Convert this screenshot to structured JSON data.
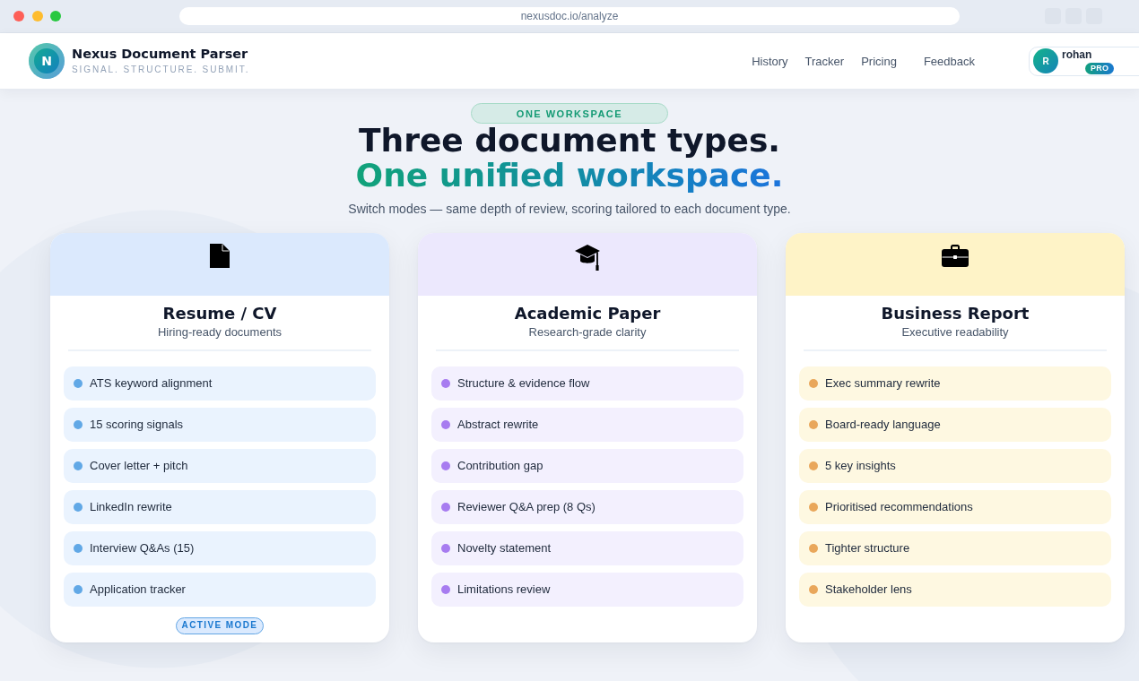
{
  "browser": {
    "url": "nexusdoc.io/analyze"
  },
  "header": {
    "logo_letter": "N",
    "title": "Nexus Document Parser",
    "tagline": "SIGNAL. STRUCTURE. SUBMIT.",
    "nav": [
      "History",
      "Tracker",
      "Pricing",
      "Feedback"
    ],
    "user": {
      "initial": "R",
      "name": "rohan",
      "plan": "PRO"
    }
  },
  "hero": {
    "badge": "ONE WORKSPACE",
    "title": "Three document types.",
    "title_accent": "One unified workspace.",
    "subtitle": "Switch modes — same depth of review, scoring tailored to each document type."
  },
  "active_mode_label": "ACTIVE MODE",
  "cards": [
    {
      "kind": "resume",
      "title": "Resume / CV",
      "subtitle": "Hiring-ready documents",
      "color": "#61a8e6",
      "selected": true,
      "features": [
        "ATS keyword alignment",
        "15 scoring signals",
        "Cover letter + pitch",
        "LinkedIn rewrite",
        "Interview Q&As (15)",
        "Application tracker"
      ]
    },
    {
      "kind": "academic",
      "title": "Academic Paper",
      "subtitle": "Research-grade clarity",
      "color": "#a77cf0",
      "selected": false,
      "features": [
        "Structure & evidence flow",
        "Abstract rewrite",
        "Contribution gap",
        "Reviewer Q&A prep (8 Qs)",
        "Novelty statement",
        "Limitations review"
      ]
    },
    {
      "kind": "business",
      "title": "Business Report",
      "subtitle": "Executive readability",
      "color": "#e9a75b",
      "selected": false,
      "features": [
        "Exec summary rewrite",
        "Board-ready language",
        "5 key insights",
        "Prioritised recommendations",
        "Tighter structure",
        "Stakeholder lens"
      ]
    }
  ]
}
